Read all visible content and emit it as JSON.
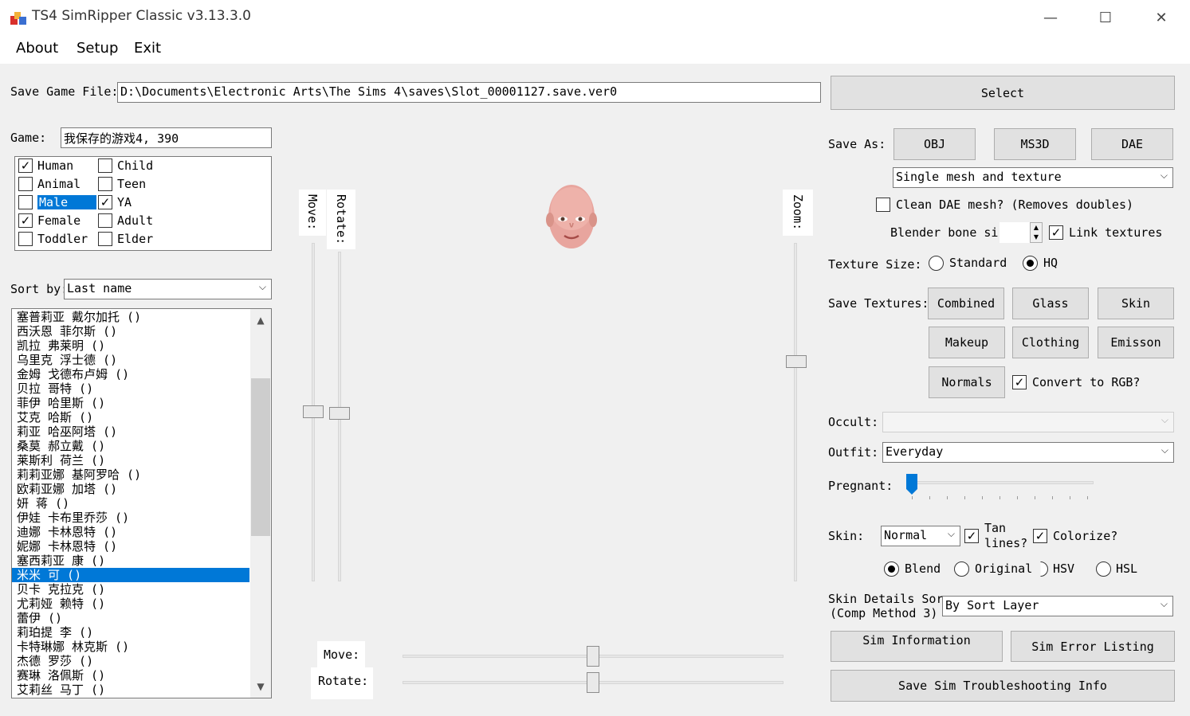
{
  "window": {
    "title": "TS4 SimRipper Classic v3.13.3.0",
    "minimize": "—",
    "maximize": "☐",
    "close": "✕"
  },
  "menu": {
    "about": "About",
    "setup": "Setup",
    "exit": "Exit"
  },
  "save_file": {
    "label": "Save Game File:",
    "value": "D:\\Documents\\Electronic Arts\\The Sims 4\\saves\\Slot_00001127.save.ver0",
    "select_button": "Select"
  },
  "game": {
    "label": "Game:",
    "value": "我保存的游戏4, 390"
  },
  "filters": [
    {
      "label": "Human",
      "checked": "✓"
    },
    {
      "label": "Child",
      "checked": ""
    },
    {
      "label": "Animal",
      "checked": ""
    },
    {
      "label": "Teen",
      "checked": ""
    },
    {
      "label": "Male",
      "checked": ""
    },
    {
      "label": "YA",
      "checked": "✓"
    },
    {
      "label": "Female",
      "checked": "✓"
    },
    {
      "label": "Adult",
      "checked": ""
    },
    {
      "label": "Toddler",
      "checked": ""
    },
    {
      "label": "Elder",
      "checked": ""
    }
  ],
  "sort": {
    "label": "Sort by:",
    "value": "Last name"
  },
  "sims": [
    "塞普莉亚 戴尔加托 ()",
    "西沃恩 菲尔斯 ()",
    "凯拉 弗莱明 ()",
    "乌里克 浮士德 ()",
    "金姆 戈德布卢姆 ()",
    "贝拉 哥特 ()",
    "菲伊 哈里斯 ()",
    "艾克 哈斯 ()",
    "莉亚 哈巫阿塔 ()",
    "桑莫 郝立戴 ()",
    "莱斯利 荷兰 ()",
    "莉莉亚娜 基阿罗哈 ()",
    "欧莉亚娜 加塔 ()",
    "妍 蒋 ()",
    "伊娃 卡布里乔莎 ()",
    "迪娜 卡林恩特 ()",
    "妮娜 卡林恩特 ()",
    "塞西莉亚 康 ()",
    "米米 可 ()",
    "贝卡 克拉克 ()",
    "尤莉娅 赖特 ()",
    "蕾伊 ()",
    "莉珀提 李 ()",
    "卡特琳娜 林克斯 ()",
    "杰德 罗莎 ()",
    "赛琳 洛佩斯 ()",
    "艾莉丝 马丁 ()"
  ],
  "preview": {
    "move_label": "Move:",
    "rotate_label": "Rotate:",
    "zoom_label": "Zoom:",
    "hmove_label": "Move:",
    "hrotate_label": "Rotate:"
  },
  "save_as": {
    "label": "Save As:",
    "obj": "OBJ",
    "ms3d": "MS3D",
    "dae": "DAE",
    "mesh_option": "Single mesh and texture"
  },
  "clean_dae": {
    "label": "Clean DAE mesh? (Removes doubles)",
    "checked": ""
  },
  "blender_bone": {
    "label": "Blender bone size"
  },
  "link_textures": {
    "label": "Link textures",
    "checked": "✓"
  },
  "texture_size": {
    "label": "Texture Size:",
    "standard": "Standard",
    "hq": "HQ"
  },
  "save_textures": {
    "label": "Save Textures:",
    "combined": "Combined",
    "glass": "Glass",
    "skin": "Skin",
    "makeup": "Makeup",
    "clothing": "Clothing",
    "emisson": "Emisson",
    "normals": "Normals",
    "convert_rgb": "Convert to RGB?",
    "convert_checked": "✓"
  },
  "occult": {
    "label": "Occult:",
    "value": ""
  },
  "outfit": {
    "label": "Outfit:",
    "value": "Everyday"
  },
  "pregnant": {
    "label": "Pregnant:",
    "level": 0
  },
  "skin": {
    "label": "Skin:",
    "value": "Normal",
    "tan_lines": "Tan\nlines?",
    "tan_checked": "✓",
    "colorize": "Colorize?",
    "colorize_checked": "✓",
    "blend": "Blend",
    "original": "Original",
    "hsv": "HSV",
    "hsl": "HSL"
  },
  "skin_details": {
    "label_line1": "Skin Details Sor",
    "label_line2": "(Comp Method 3)",
    "value": "By Sort Layer"
  },
  "actions": {
    "sim_information": "Sim Information",
    "sim_error_listing": "Sim Error Listing",
    "save_troubleshooting": "Save Sim Troubleshooting Info"
  },
  "colors": {
    "accent": "#0078d7",
    "window_bg": "#f0f0f0",
    "button_bg": "#e1e1e1"
  }
}
